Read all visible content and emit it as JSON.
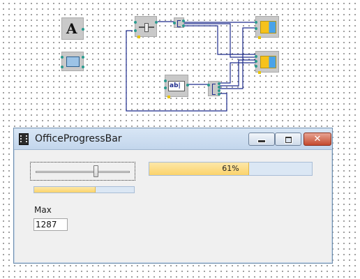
{
  "window": {
    "title": "OfficeProgressBar"
  },
  "controls": {
    "slider_value_fraction": 0.65,
    "main_progress_fraction": 0.61,
    "main_progress_text": "61%",
    "small_progress_fraction": 0.61,
    "max_label": "Max",
    "max_value": "1287"
  },
  "diagram": {
    "nodes": [
      "text-label-node",
      "panel-node",
      "slider-node",
      "splitter-node-top",
      "progressbar-node-1",
      "progressbar-node-2",
      "textbox-node",
      "splitter-node-bottom"
    ]
  },
  "colors": {
    "progress_fill": "#fbd36b",
    "progress_track": "#dbe7f4",
    "wire": "#1c2a8c",
    "pin": "#2a9b8f"
  }
}
